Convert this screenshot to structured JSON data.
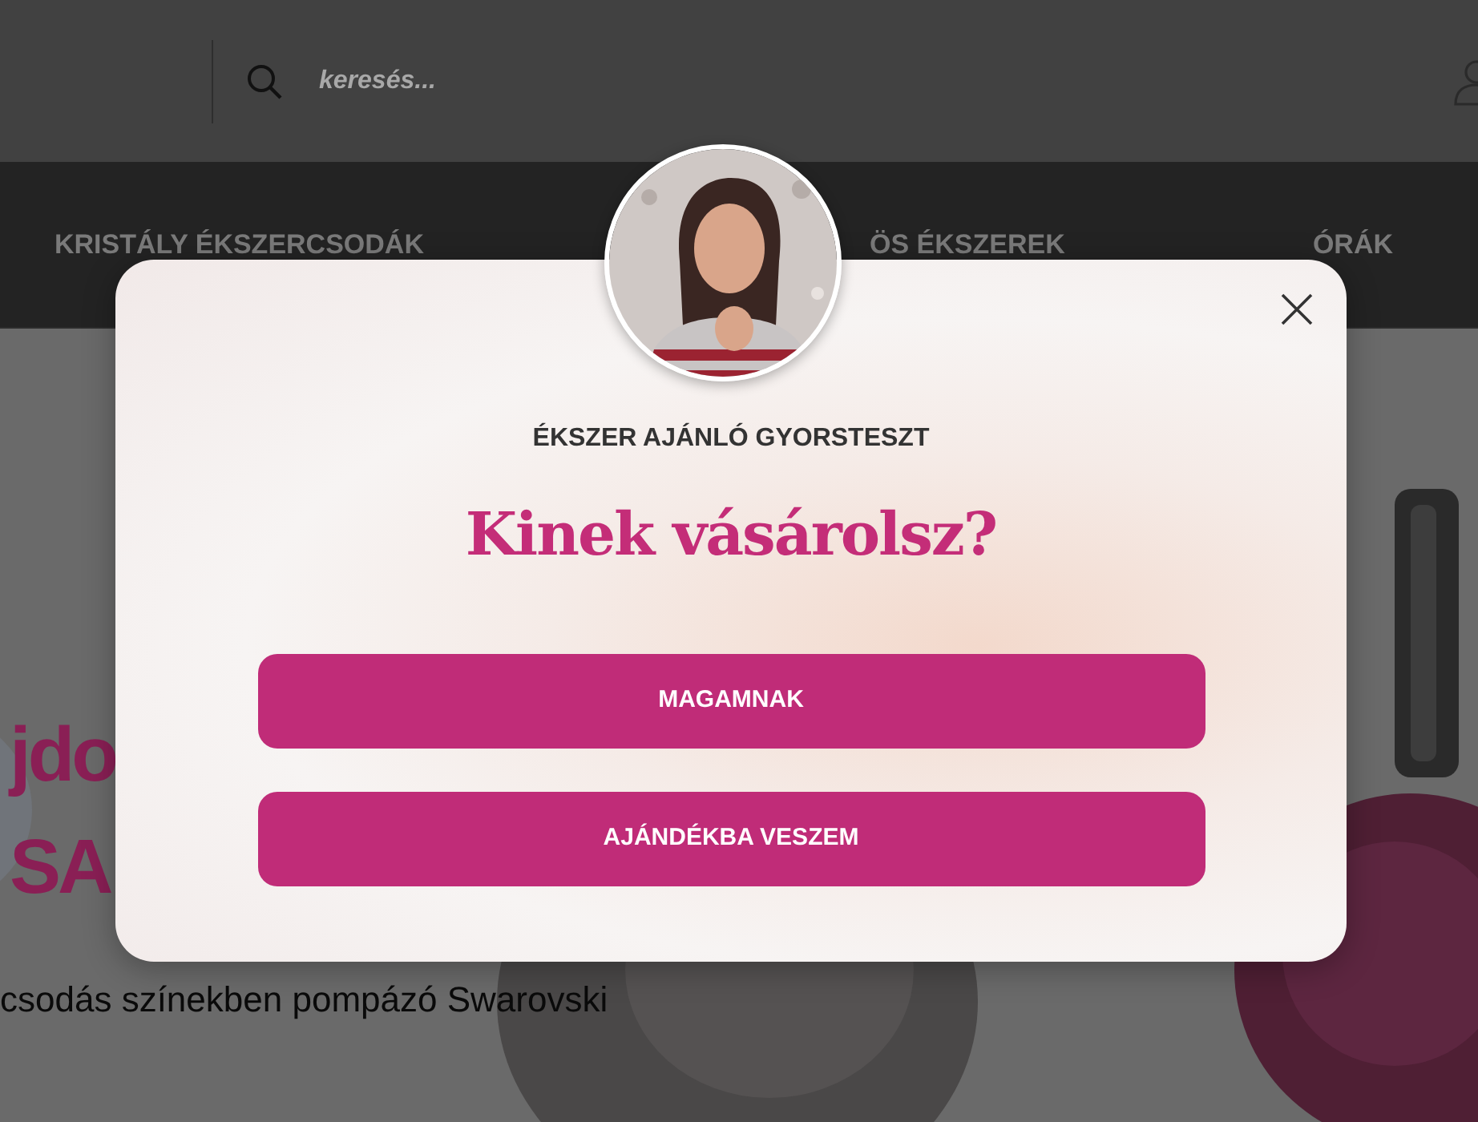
{
  "header": {
    "search": {
      "placeholder": "keresés..."
    }
  },
  "nav": {
    "items": [
      {
        "label": "KRISTÁLY ÉKSZERCSODÁK"
      },
      {
        "label": "ÖS ÉKSZEREK"
      },
      {
        "label": "ÓRÁK"
      }
    ]
  },
  "hero": {
    "title_lines": [
      "jdo",
      "SA"
    ],
    "subtitle": "csodás színekben pompázó Swarovski"
  },
  "modal": {
    "eyebrow": "ÉKSZER AJÁNLÓ GYORSTESZT",
    "title": "Kinek vásárolsz?",
    "options": [
      "MAGAMNAK",
      "AJÁNDÉKBA VESZEM"
    ]
  }
}
